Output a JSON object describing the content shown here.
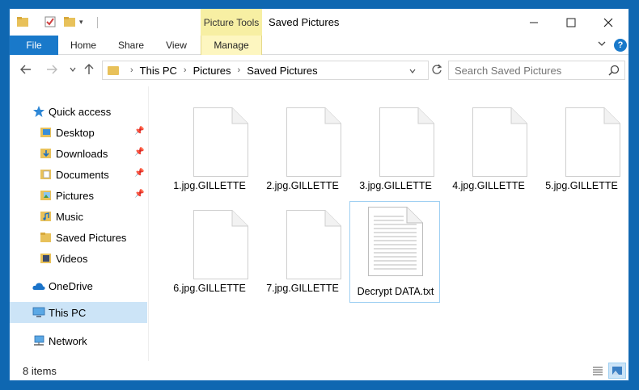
{
  "window": {
    "title": "Saved Pictures",
    "context_tab_group": "Picture Tools"
  },
  "ribbon": {
    "tabs": [
      {
        "label": "File"
      },
      {
        "label": "Home"
      },
      {
        "label": "Share"
      },
      {
        "label": "View"
      },
      {
        "label": "Manage"
      }
    ]
  },
  "address": {
    "breadcrumbs": [
      "This PC",
      "Pictures",
      "Saved Pictures"
    ]
  },
  "search": {
    "placeholder": "Search Saved Pictures"
  },
  "navpane": {
    "items": [
      {
        "label": "Quick access",
        "icon": "star-icon"
      },
      {
        "label": "Desktop",
        "icon": "desktop-folder-icon",
        "pinned": true
      },
      {
        "label": "Downloads",
        "icon": "downloads-folder-icon",
        "pinned": true
      },
      {
        "label": "Documents",
        "icon": "documents-folder-icon",
        "pinned": true
      },
      {
        "label": "Pictures",
        "icon": "pictures-folder-icon",
        "pinned": true
      },
      {
        "label": "Music",
        "icon": "music-folder-icon"
      },
      {
        "label": "Saved Pictures",
        "icon": "folder-icon"
      },
      {
        "label": "Videos",
        "icon": "videos-folder-icon"
      },
      {
        "label": "OneDrive",
        "icon": "cloud-icon"
      },
      {
        "label": "This PC",
        "icon": "computer-icon",
        "selected": true
      },
      {
        "label": "Network",
        "icon": "network-icon"
      }
    ]
  },
  "files": [
    {
      "name": "1.jpg.GILLETTE",
      "type": "blank"
    },
    {
      "name": "2.jpg.GILLETTE",
      "type": "blank"
    },
    {
      "name": "3.jpg.GILLETTE",
      "type": "blank"
    },
    {
      "name": "4.jpg.GILLETTE",
      "type": "blank"
    },
    {
      "name": "5.jpg.GILLETTE",
      "type": "blank"
    },
    {
      "name": "6.jpg.GILLETTE",
      "type": "blank"
    },
    {
      "name": "7.jpg.GILLETTE",
      "type": "blank"
    },
    {
      "name": "Decrypt DATA.txt",
      "type": "text",
      "selected": true
    }
  ],
  "status": {
    "item_count": "8 items"
  },
  "colors": {
    "accent": "#1979ca",
    "context_tab": "#f7efa3",
    "selection": "#cce4f7",
    "folder": "#e8c15a"
  }
}
